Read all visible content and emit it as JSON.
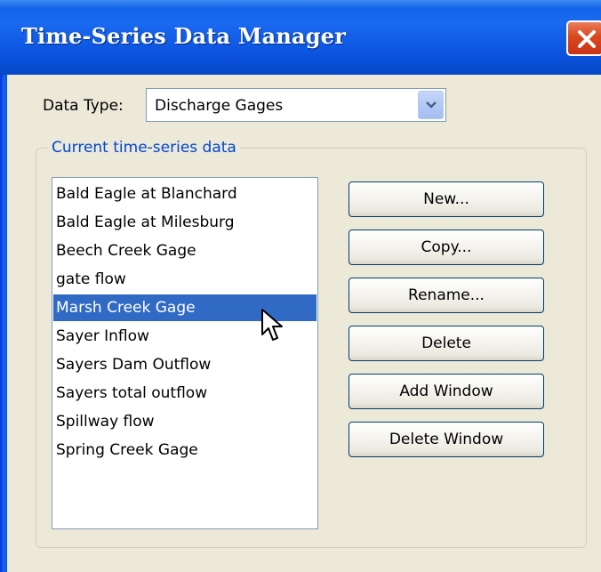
{
  "window": {
    "title": "Time-Series Data Manager",
    "close_label": "close"
  },
  "data_type": {
    "label": "Data Type:",
    "selected": "Discharge Gages"
  },
  "group": {
    "legend": "Current time-series data"
  },
  "list": {
    "items": [
      "Bald Eagle at Blanchard",
      "Bald Eagle at Milesburg",
      "Beech Creek Gage",
      "gate flow",
      "Marsh Creek Gage",
      "Sayer Inflow",
      "Sayers Dam Outflow",
      "Sayers total outflow",
      "Spillway flow",
      "Spring Creek Gage"
    ],
    "selected_index": 4
  },
  "buttons": {
    "new": "New...",
    "copy": "Copy...",
    "rename": "Rename...",
    "delete": "Delete",
    "add_window": "Add Window",
    "delete_window": "Delete Window"
  },
  "colors": {
    "title_bar": "#0a5fd8",
    "selection": "#316ac5",
    "group_legend": "#0046d5"
  }
}
